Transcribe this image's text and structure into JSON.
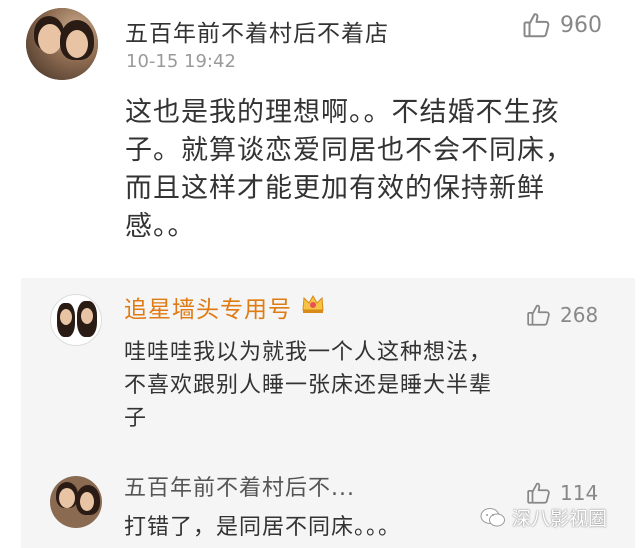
{
  "post": {
    "author": "五百年前不着村后不着店",
    "timestamp": "10-15 19:42",
    "likes": "960",
    "text": "这也是我的理想啊。。不结婚不生孩\n子。就算谈恋爱同居也不会不同床，\n而且这样才能更加有效的保持新鲜\n感。。"
  },
  "replies": [
    {
      "author": "追星墙头专用号",
      "likes": "268",
      "text": "哇哇哇我以为就我一个人这种想法，\n不喜欢跟别人睡一张床还是睡大半辈\n子"
    },
    {
      "author": "五百年前不着村后不...",
      "likes": "114",
      "text": "打错了，是同居不同床。。。"
    }
  ],
  "watermark": "深八影视圈",
  "colors": {
    "accent": "#e07a12",
    "text": "#333333",
    "muted": "#9a9a9a",
    "reply_bg": "#f5f5f5"
  },
  "icons": [
    "thumbs-up-icon",
    "crown-icon",
    "wechat-icon"
  ]
}
